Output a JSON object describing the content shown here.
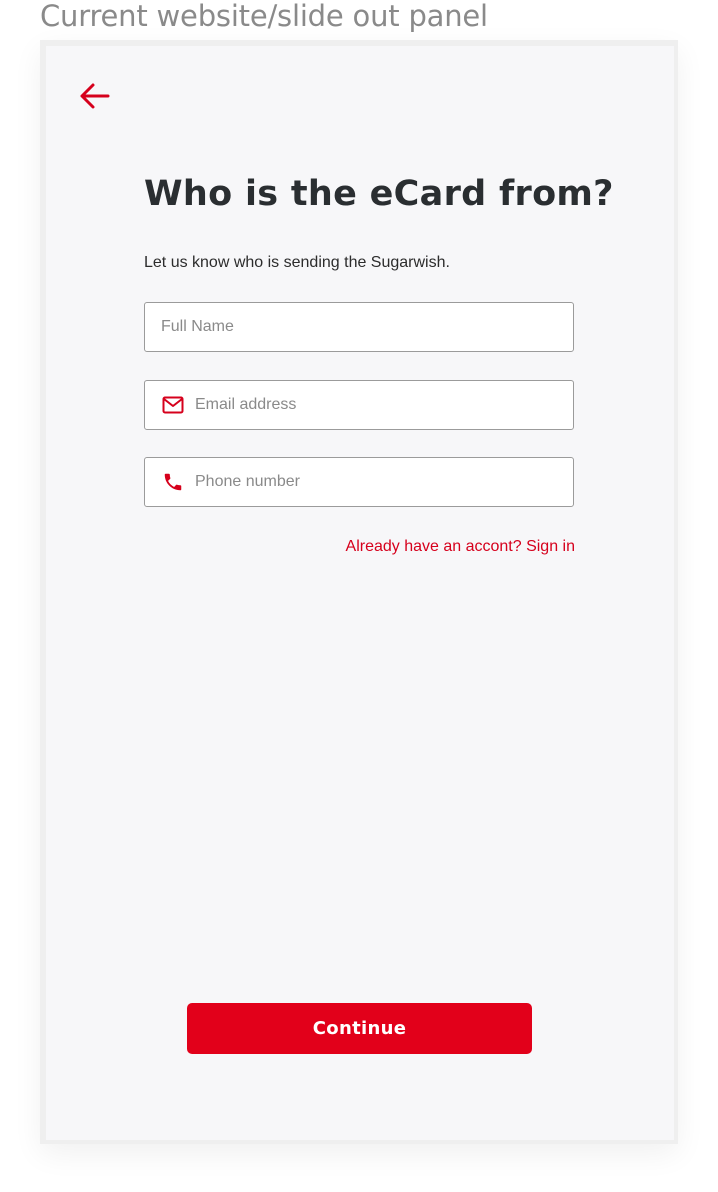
{
  "caption": "Current website/slide out panel",
  "colors": {
    "accent": "#e2001a",
    "link": "#d6001c",
    "heading": "#2a2e31",
    "panel_background": "#f7f7f9"
  },
  "panel": {
    "back_icon": "arrow-left-icon",
    "heading": "Who is the eCard from?",
    "subtext": "Let us know who is sending the Sugarwish.",
    "fields": {
      "full_name": {
        "placeholder": "Full Name",
        "value": ""
      },
      "email": {
        "icon": "mail-icon",
        "placeholder": "Email address",
        "value": ""
      },
      "phone": {
        "icon": "phone-icon",
        "placeholder": "Phone number",
        "value": ""
      }
    },
    "signin_link": "Already have an accont? Sign in",
    "continue_label": "Continue"
  }
}
